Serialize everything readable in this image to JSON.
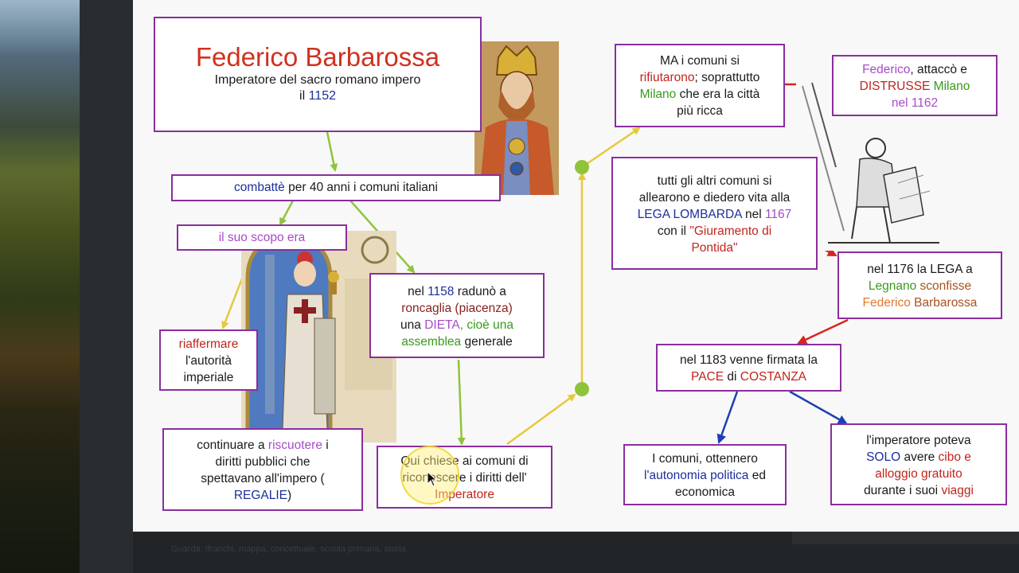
{
  "title_box": {
    "title": "Federico Barbarossa",
    "subtitle": "Imperatore del sacro romano impero",
    "year_prefix": "il ",
    "year": "1152"
  },
  "nodes": {
    "combatte": {
      "a": "combattè",
      "b": " per 40 anni i comuni italiani"
    },
    "scopo": {
      "a": "il suo scopo era"
    },
    "riaffermare": {
      "l1": "riaffermare",
      "l2": "l'autorità",
      "l3": "imperiale"
    },
    "roncaglia": {
      "l1a": "nel ",
      "l1b": "1158",
      "l1c": " radunò a",
      "l2": "roncaglia (piacenza)",
      "l3a": "una ",
      "l3b": "DIETA",
      "l3c": ", cioè una",
      "l4a": "assemblea",
      "l4b": " generale"
    },
    "riscuotere": {
      "l1a": "continuare a ",
      "l1b": "riscuotere",
      "l1c": " i",
      "l2": "diritti pubblici che",
      "l3": "spettavano all'impero (",
      "l4a": "REGALIE",
      "l4b": ")"
    },
    "chiese": {
      "l1": "Qui chiese ai comuni di",
      "l2": "riconoscere i diritti dell'",
      "l3": "Imperatore"
    },
    "rifiutarono": {
      "l1": "MA i comuni si",
      "l2a": "rifiutarono",
      "l2b": "; soprattutto",
      "l3a": "Milano",
      "l3b": " che era la città",
      "l4": "più ricca"
    },
    "distrusse": {
      "l1a": "Federico",
      "l1b": ", attaccò e",
      "l2a": "DISTRUSSE",
      "l2b": " Milano",
      "l3": "nel 1162"
    },
    "lega": {
      "l1": "tutti gli altri comuni si",
      "l2": "allearono e diedero vita alla",
      "l3a": "LEGA LOMBARDA",
      "l3b": " nel ",
      "l3c": "1167",
      "l4a": "con il ",
      "l4b": "\"Giuramento di",
      "l5": "Pontida\""
    },
    "legnano": {
      "l1": "nel 1176 la LEGA a",
      "l2a": "Legnano",
      "l2b": " sconfisse",
      "l3a": "Federico",
      "l3b": " Barbarossa"
    },
    "costanza": {
      "l1": "nel 1183 venne firmata la",
      "l2a": "PACE",
      "l2b": " di ",
      "l2c": "COSTANZA"
    },
    "autonomia": {
      "l1": "I comuni, ottennero",
      "l2a": "l'autonomia politica",
      "l2b": " ed",
      "l3": "economica"
    },
    "solo": {
      "l1": "l'imperatore poteva",
      "l2a": "SOLO",
      "l2b": " avere ",
      "l2c": "cibo e",
      "l3": "alloggio gratuito",
      "l4a": "durante i suoi ",
      "l4b": "viaggi"
    }
  },
  "footer_caption": "Guarda: Ifranchi, mappa, concettuale, scuola primaria, storia",
  "colors": {
    "border": "#8a2e9e",
    "title_red": "#d0311f",
    "arrow_green": "#8fc43a",
    "arrow_yellow": "#e6c93a",
    "arrow_red": "#d4261e",
    "arrow_blue": "#1c3fb4"
  },
  "icons": {
    "cursor": "arrow-cursor-icon"
  }
}
